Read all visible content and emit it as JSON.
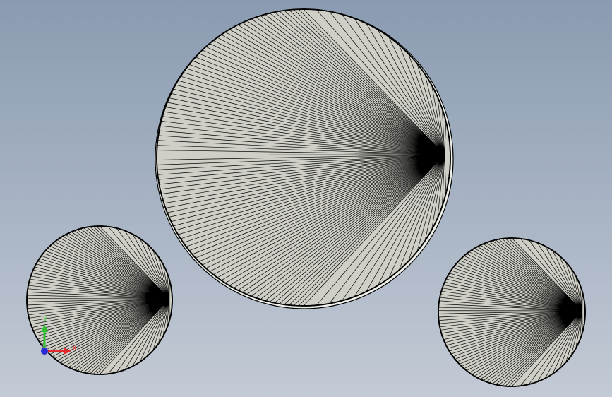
{
  "viewport": {
    "background_top": "#8a9bb1",
    "background_bottom": "#c3cad5"
  },
  "model": {
    "face_color": "#cfcfc7",
    "edge_color": "#000000",
    "rim_color": "#f0f0ea",
    "parts": [
      {
        "name": "large-disc",
        "segments": 96
      },
      {
        "name": "left-disc",
        "segments": 72
      },
      {
        "name": "right-disc",
        "segments": 72
      }
    ]
  },
  "triad": {
    "x_label": "X",
    "y_label": "Y",
    "x_color": "#e32a2a",
    "y_color": "#2fc02f",
    "z_color": "#2b2bd6"
  }
}
